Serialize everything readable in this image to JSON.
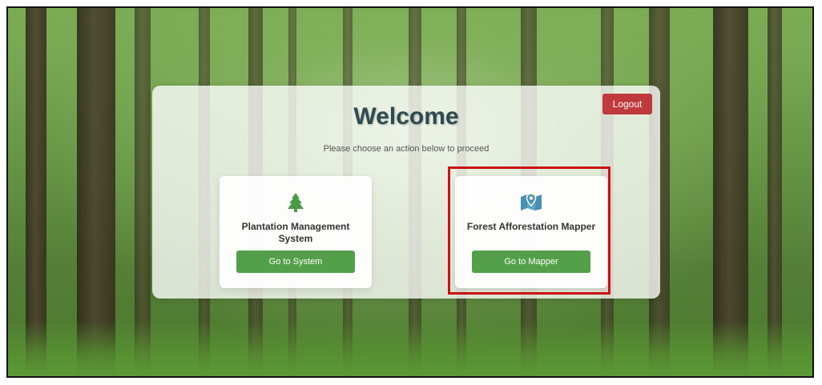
{
  "panel": {
    "title": "Welcome",
    "subtitle": "Please choose an action below to proceed",
    "logout_label": "Logout"
  },
  "cards": [
    {
      "icon": "tree-icon",
      "title": "Plantation Management System",
      "button_label": "Go to System"
    },
    {
      "icon": "map-marker-icon",
      "title": "Forest Afforestation Mapper",
      "button_label": "Go to Mapper"
    }
  ],
  "colors": {
    "logout": "#c0393c",
    "button": "#54a04a",
    "title": "#2f4a50",
    "icon_tree": "#4a9a45",
    "icon_map": "#4a8fb0",
    "highlight": "#cc1111"
  }
}
